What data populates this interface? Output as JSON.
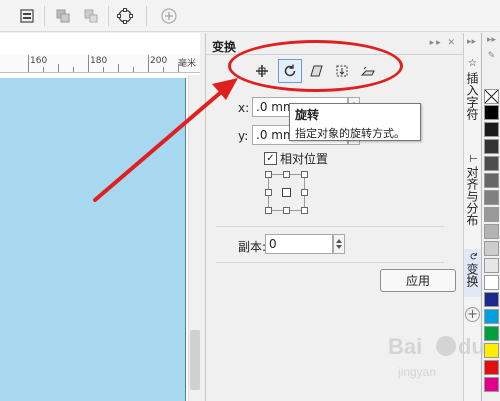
{
  "docker": {
    "title": "变换",
    "x_label": "x:",
    "x_value": ".0 mm",
    "y_label": "y:",
    "y_value": ".0 mm",
    "relative_position_label": "相对位置",
    "relative_position_checked": true,
    "copies_label": "副本:",
    "copies_value": "0",
    "apply_label": "应用"
  },
  "tooltip": {
    "title": "旋转",
    "description": "指定对象的旋转方式。"
  },
  "mode_buttons": [
    "position",
    "rotate",
    "scale-mirror",
    "size",
    "skew"
  ],
  "active_mode": "rotate",
  "ruler": {
    "numbers": [
      "160",
      "180",
      "200"
    ],
    "unit": "毫米"
  },
  "vertical_tabs": [
    "插入字符",
    "对齐与分布",
    "变换"
  ],
  "active_tab": "变换",
  "palette_colors": [
    "#ffffff",
    "#000000",
    "#1a1a1a",
    "#333333",
    "#4d4d4d",
    "#666666",
    "#808080",
    "#999999",
    "#b3b3b3",
    "#cccccc",
    "#e6e6e6",
    "#ffffff",
    "#1a2a8a",
    "#00a0e0",
    "#00a040",
    "#ffee00",
    "#e01010",
    "#e0008a"
  ],
  "colors": {
    "canvas_page": "#a8d8f0",
    "highlight": "#e02020",
    "active_tab": "#dfe8f4"
  }
}
